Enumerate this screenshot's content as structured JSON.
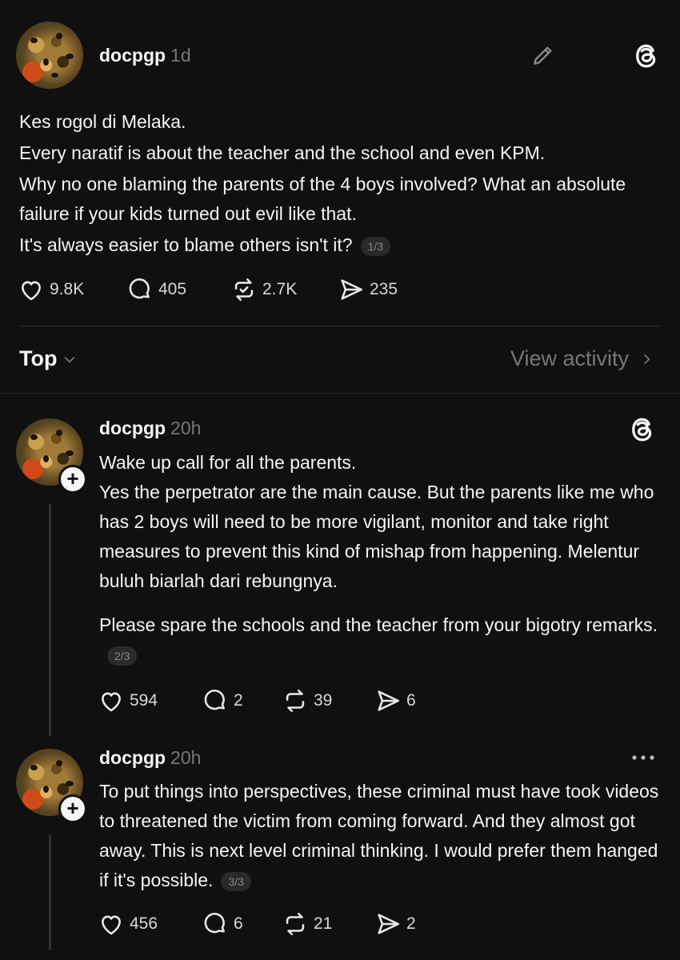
{
  "main_post": {
    "username": "docpgp",
    "time": "1d",
    "lines": [
      "Kes rogol di Melaka.",
      "Every naratif is about the teacher and the school and even KPM.",
      "Why no one blaming the parents of the 4 boys involved? What an absolute failure if your kids turned out evil like that.",
      "It's always easier to blame others isn't it?"
    ],
    "pager": "1/3",
    "likes": "9.8K",
    "comments": "405",
    "reposts": "2.7K",
    "shares": "235"
  },
  "sort": {
    "label": "Top",
    "view_activity": "View activity"
  },
  "replies": [
    {
      "username": "docpgp",
      "time": "20h",
      "paragraph1": "Wake up call for all the parents.",
      "paragraph2": "Yes the perpetrator are the main cause. But the parents like me who has 2 boys will need to be more vigilant, monitor and take right measures to prevent this kind of mishap from happening. Melentur buluh biarlah dari rebungnya.",
      "paragraph3": "Please spare the schools and the teacher from your bigotry remarks.",
      "pager": "2/3",
      "likes": "594",
      "comments": "2",
      "reposts": "39",
      "shares": "6"
    },
    {
      "username": "docpgp",
      "time": "20h",
      "paragraph1": "To put things into perspectives, these criminal must have took videos to threatened the victim from coming forward. And they almost got away. This is next level criminal thinking. I would prefer them hanged if it's possible.",
      "pager": "3/3",
      "likes": "456",
      "comments": "6",
      "reposts": "21",
      "shares": "2"
    }
  ],
  "icons": {
    "edit": "pencil-icon",
    "threads": "threads-logo-icon",
    "more": "more-options-icon",
    "like": "heart-icon",
    "comment": "comment-icon",
    "repost": "repost-icon",
    "share": "share-icon",
    "chevron_down": "chevron-down-icon",
    "chevron_right": "chevron-right-icon"
  },
  "colors": {
    "background": "#101010",
    "text": "#f3f5f7",
    "muted": "#777777",
    "divider": "#2c2c2c"
  }
}
